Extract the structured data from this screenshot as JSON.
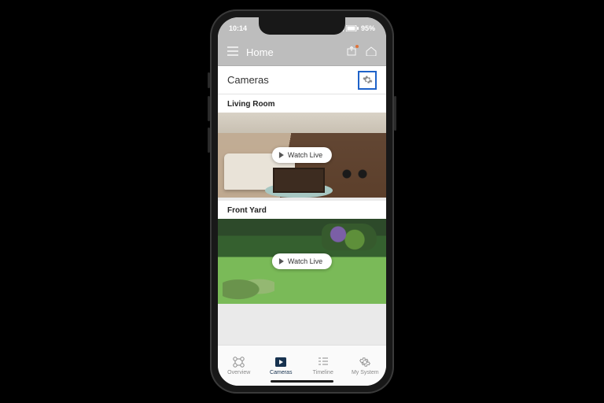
{
  "status": {
    "time": "10:14",
    "battery_text": "95%"
  },
  "header": {
    "title": "Home",
    "menu_icon": "hamburger-icon",
    "share_icon": "share-icon",
    "home_icon": "home-icon"
  },
  "section": {
    "title": "Cameras",
    "settings_icon": "gear-icon"
  },
  "cameras": [
    {
      "name": "Living Room",
      "watch_label": "Watch Live"
    },
    {
      "name": "Front Yard",
      "watch_label": "Watch Live"
    }
  ],
  "tabs": [
    {
      "label": "Overview",
      "icon": "grid-icon",
      "active": false
    },
    {
      "label": "Cameras",
      "icon": "play-box-icon",
      "active": true
    },
    {
      "label": "Timeline",
      "icon": "timeline-icon",
      "active": false
    },
    {
      "label": "My System",
      "icon": "gear-icon",
      "active": false
    }
  ]
}
